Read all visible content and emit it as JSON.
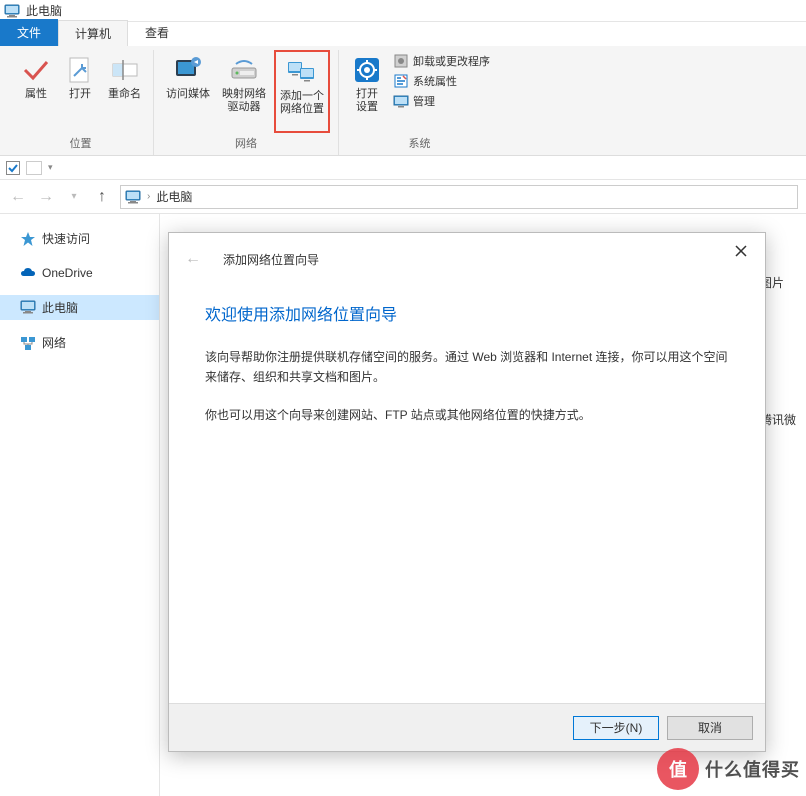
{
  "window": {
    "title": "此电脑"
  },
  "tabs": {
    "file": "文件",
    "computer": "计算机",
    "view": "查看"
  },
  "ribbon": {
    "location": {
      "label": "位置",
      "properties": "属性",
      "open": "打开",
      "rename": "重命名"
    },
    "network": {
      "label": "网络",
      "access_media": "访问媒体",
      "map_drive": "映射网络\n驱动器",
      "add_location": "添加一个\n网络位置"
    },
    "system": {
      "label": "系统",
      "open_settings": "打开\n设置",
      "uninstall": "卸载或更改程序",
      "sys_props": "系统属性",
      "manage": "管理"
    }
  },
  "address": {
    "location": "此电脑"
  },
  "sidebar": {
    "quick_access": "快速访问",
    "onedrive": "OneDrive",
    "this_pc": "此电脑",
    "network": "网络"
  },
  "content_labels": {
    "pictures": "图片",
    "tencent": "腾讯微"
  },
  "wizard": {
    "title_small": "添加网络位置向导",
    "heading": "欢迎使用添加网络位置向导",
    "para1": "该向导帮助你注册提供联机存储空间的服务。通过 Web 浏览器和 Internet 连接，你可以用这个空间来储存、组织和共享文档和图片。",
    "para2": "你也可以用这个向导来创建网站、FTP 站点或其他网络位置的快捷方式。",
    "next": "下一步(N)",
    "cancel": "取消"
  },
  "watermark": {
    "badge": "值",
    "text": "什么值得买"
  }
}
